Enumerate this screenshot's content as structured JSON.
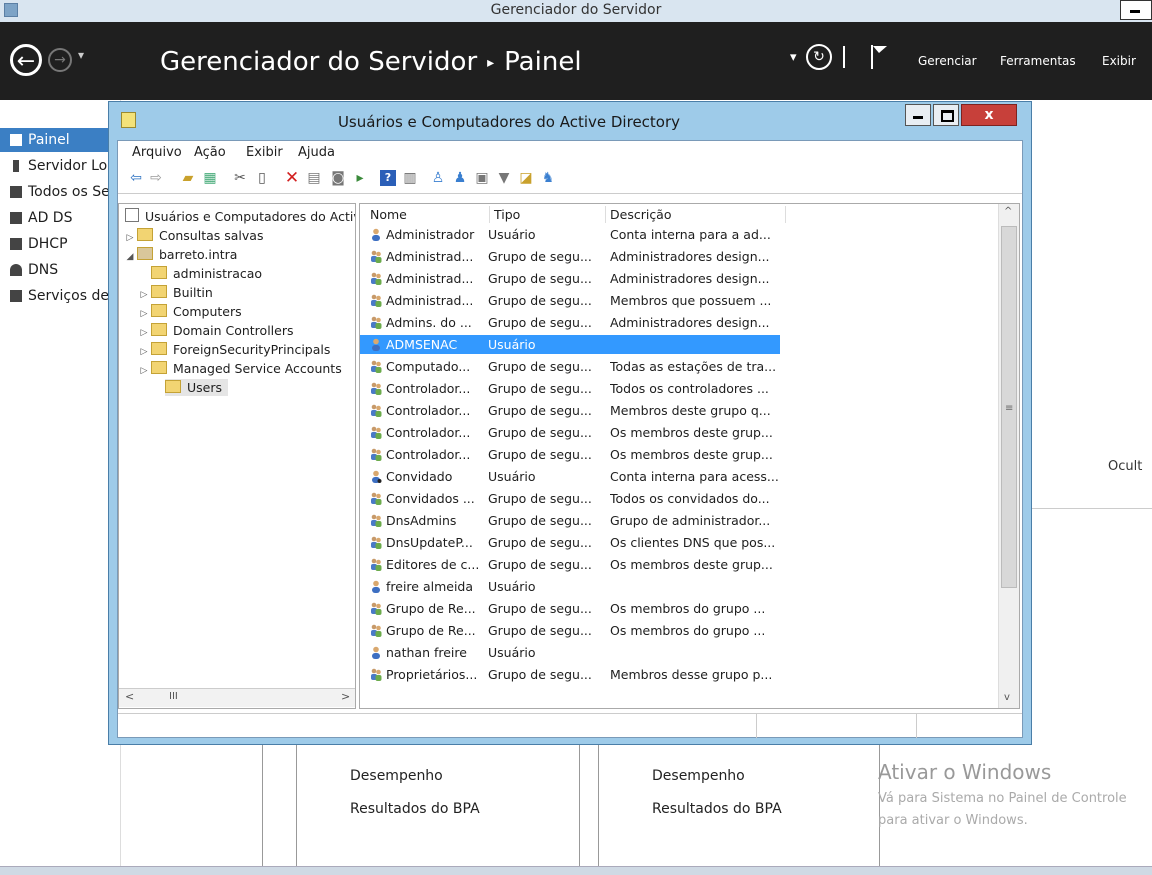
{
  "sm": {
    "window_title": "Gerenciador do Servidor",
    "breadcrumb_app": "Gerenciador do Servidor",
    "breadcrumb_page": "Painel",
    "menu_manage": "Gerenciar",
    "menu_tools": "Ferramentas",
    "menu_view": "Exibir",
    "hidden_text": "Ocult",
    "sidebar": [
      {
        "label": "Painel",
        "active": true
      },
      {
        "label": "Servidor Local"
      },
      {
        "label": "Todos os Servidores"
      },
      {
        "label": "AD DS"
      },
      {
        "label": "DHCP"
      },
      {
        "label": "DNS"
      },
      {
        "label": "Serviços de Arquivo"
      }
    ],
    "tiles": {
      "left": {
        "perf": "Desempenho",
        "bpa": "Resultados do BPA"
      },
      "right": {
        "perf": "Desempenho",
        "bpa": "Resultados do BPA"
      }
    },
    "activate": {
      "title": "Ativar o Windows",
      "line1": "Vá para Sistema no Painel de Controle",
      "line2": "para ativar o Windows."
    }
  },
  "ad": {
    "title": "Usuários e Computadores do Active Directory",
    "close_label": "x",
    "menu": [
      "Arquivo",
      "Ação",
      "Exibir",
      "Ajuda"
    ],
    "tree": {
      "root": "Usuários e Computadores do Active Directory",
      "saved": "Consultas salvas",
      "domain": "barreto.intra",
      "children": [
        "administracao",
        "Builtin",
        "Computers",
        "Domain Controllers",
        "ForeignSecurityPrincipals",
        "Managed Service Accounts",
        "Users"
      ]
    },
    "columns": [
      "Nome",
      "Tipo",
      "Descrição"
    ],
    "rows": [
      {
        "name": "Administrador",
        "type": "Usuário",
        "desc": "Conta interna para a ad...",
        "kind": "user"
      },
      {
        "name": "Administrad...",
        "type": "Grupo de segu...",
        "desc": "Administradores design...",
        "kind": "group"
      },
      {
        "name": "Administrad...",
        "type": "Grupo de segu...",
        "desc": "Administradores design...",
        "kind": "group"
      },
      {
        "name": "Administrad...",
        "type": "Grupo de segu...",
        "desc": "Membros que possuem ...",
        "kind": "group"
      },
      {
        "name": "Admins. do ...",
        "type": "Grupo de segu...",
        "desc": "Administradores design...",
        "kind": "group"
      },
      {
        "name": "ADMSENAC",
        "type": "Usuário",
        "desc": "",
        "kind": "user",
        "selected": true
      },
      {
        "name": "Computado...",
        "type": "Grupo de segu...",
        "desc": "Todas as estações de tra...",
        "kind": "group"
      },
      {
        "name": "Controlador...",
        "type": "Grupo de segu...",
        "desc": "Todos os controladores ...",
        "kind": "group"
      },
      {
        "name": "Controlador...",
        "type": "Grupo de segu...",
        "desc": "Membros deste grupo q...",
        "kind": "group"
      },
      {
        "name": "Controlador...",
        "type": "Grupo de segu...",
        "desc": "Os membros deste grup...",
        "kind": "group"
      },
      {
        "name": "Controlador...",
        "type": "Grupo de segu...",
        "desc": "Os membros deste grup...",
        "kind": "group"
      },
      {
        "name": "Convidado",
        "type": "Usuário",
        "desc": "Conta interna para acess...",
        "kind": "user-disabled"
      },
      {
        "name": "Convidados ...",
        "type": "Grupo de segu...",
        "desc": "Todos os convidados do...",
        "kind": "group"
      },
      {
        "name": "DnsAdmins",
        "type": "Grupo de segu...",
        "desc": "Grupo de administrador...",
        "kind": "group"
      },
      {
        "name": "DnsUpdateP...",
        "type": "Grupo de segu...",
        "desc": "Os clientes DNS que pos...",
        "kind": "group"
      },
      {
        "name": "Editores de c...",
        "type": "Grupo de segu...",
        "desc": "Os membros deste grup...",
        "kind": "group"
      },
      {
        "name": "freire almeida",
        "type": "Usuário",
        "desc": "",
        "kind": "user"
      },
      {
        "name": "Grupo de Re...",
        "type": "Grupo de segu...",
        "desc": "Os membros do grupo ...",
        "kind": "group"
      },
      {
        "name": "Grupo de Re...",
        "type": "Grupo de segu...",
        "desc": "Os membros do grupo ...",
        "kind": "group"
      },
      {
        "name": "nathan freire",
        "type": "Usuário",
        "desc": "",
        "kind": "user"
      },
      {
        "name": "Proprietários...",
        "type": "Grupo de segu...",
        "desc": "Membros desse grupo p...",
        "kind": "group"
      }
    ]
  },
  "colors": {
    "selection": "#3399ff",
    "accent": "#3b7fc4",
    "window_frame": "#9ecbe9",
    "header_bg": "#1f1f1f",
    "close_red": "#c7403a"
  }
}
